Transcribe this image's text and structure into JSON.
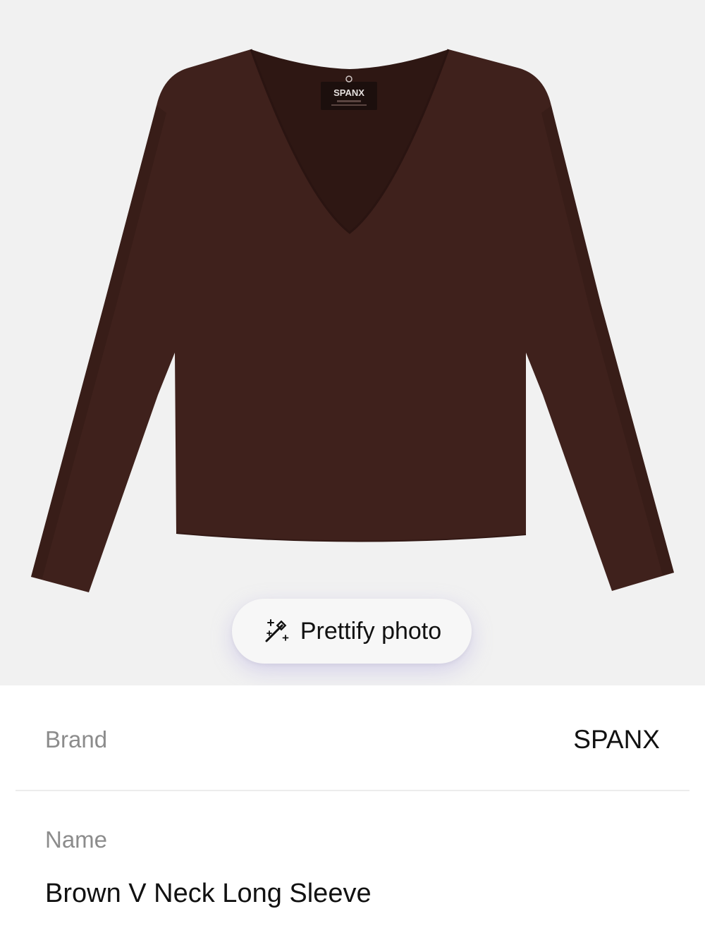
{
  "product_photo": {
    "garment_color": "#3f211c",
    "label_text": "SPANX",
    "background_color": "#f1f1f1"
  },
  "prettify": {
    "label": "Prettify photo",
    "icon": "magic-wand-sparkles-icon"
  },
  "details": {
    "brand": {
      "label": "Brand",
      "value": "SPANX"
    },
    "name": {
      "label": "Name",
      "value": "Brown V Neck Long Sleeve"
    }
  }
}
